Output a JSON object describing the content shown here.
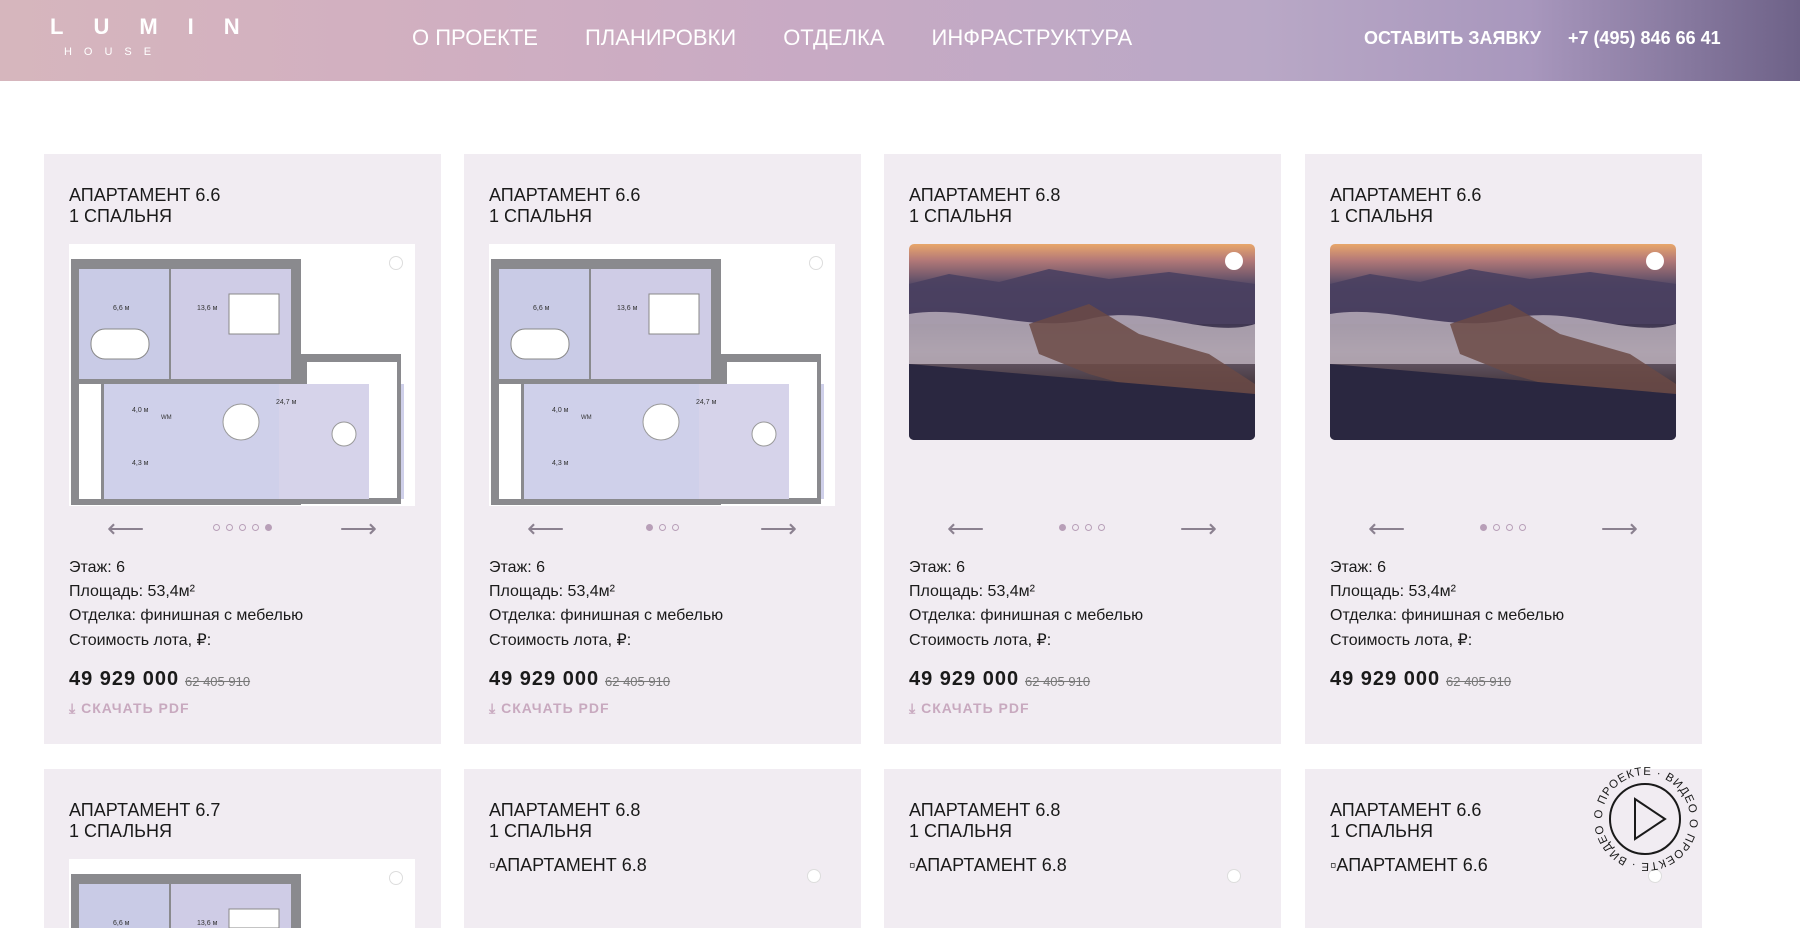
{
  "header": {
    "logo_main": "LUMIN",
    "logo_sub": "HOUSE",
    "nav": [
      "О ПРОЕКТЕ",
      "ПЛАНИРОВКИ",
      "ОТДЕЛКА",
      "ИНФРАСТРУКТУРА"
    ],
    "cta": "ОСТАВИТЬ ЗАЯВКУ",
    "phone": "+7 (495) 846 66 41"
  },
  "cards": [
    {
      "title": "АПАРТАМЕНТ 6.6",
      "subtitle": "1 СПАЛЬНЯ",
      "floor": "Этаж: 6",
      "area": "Площадь: 53,4м²",
      "finish": "Отделка: финишная с мебелью",
      "cost_label": "Стоимость лота, ₽:",
      "price": "49 929 000",
      "old_price": "62 405 910",
      "pdf": "СКАЧАТЬ PDF",
      "room_labels": [
        "6,6 м",
        "13,6 м",
        "24,7 м",
        "4,0 м",
        "4,3 м",
        "WM"
      ]
    },
    {
      "title": "АПАРТАМЕНТ 6.6",
      "subtitle": "1 СПАЛЬНЯ",
      "floor": "Этаж: 6",
      "area": "Площадь: 53,4м²",
      "finish": "Отделка: финишная с мебелью",
      "cost_label": "Стоимость лота, ₽:",
      "price": "49 929 000",
      "old_price": "62 405 910",
      "pdf": "СКАЧАТЬ PDF",
      "room_labels": [
        "6,6 м",
        "13,6 м",
        "24,7 м",
        "4,0 м",
        "4,3 м",
        "WM"
      ]
    },
    {
      "title": "АПАРТАМЕНТ 6.8",
      "subtitle": "1 СПАЛЬНЯ",
      "floor": "Этаж: 6",
      "area": "Площадь: 53,4м²",
      "finish": "Отделка: финишная с мебелью",
      "cost_label": "Стоимость лота, ₽:",
      "price": "49 929 000",
      "old_price": "62 405 910",
      "pdf": "СКАЧАТЬ PDF"
    },
    {
      "title": "АПАРТАМЕНТ 6.6",
      "subtitle": "1 СПАЛЬНЯ",
      "floor": "Этаж: 6",
      "area": "Площадь: 53,4м²",
      "finish": "Отделка: финишная с мебелью",
      "cost_label": "Стоимость лота, ₽:",
      "price": "49 929 000",
      "old_price": "62 405 910"
    }
  ],
  "cards_row2": [
    {
      "title": "АПАРТАМЕНТ 6.7",
      "subtitle": "1 СПАЛЬНЯ",
      "room_labels": [
        "6,6 м",
        "13,6 м"
      ]
    },
    {
      "title": "АПАРТАМЕНТ 6.8",
      "subtitle": "1 СПАЛЬНЯ",
      "alt": "АПАРТАМЕНТ 6.8"
    },
    {
      "title": "АПАРТАМЕНТ 6.8",
      "subtitle": "1 СПАЛЬНЯ",
      "alt": "АПАРТАМЕНТ 6.8"
    },
    {
      "title": "АПАРТАМЕНТ 6.6",
      "subtitle": "1 СПАЛЬНЯ",
      "alt": "АПАРТАМЕНТ 6.6"
    }
  ],
  "video_badge": "О ПРОЕКТЕ · ВИДЕО О ПРОЕКТЕ · ВИДЕО",
  "icons": {
    "zoom": "magnifier-icon",
    "play": "play-icon",
    "arrow_left": "arrow-left-icon",
    "arrow_right": "arrow-right-icon",
    "download": "download-icon"
  }
}
